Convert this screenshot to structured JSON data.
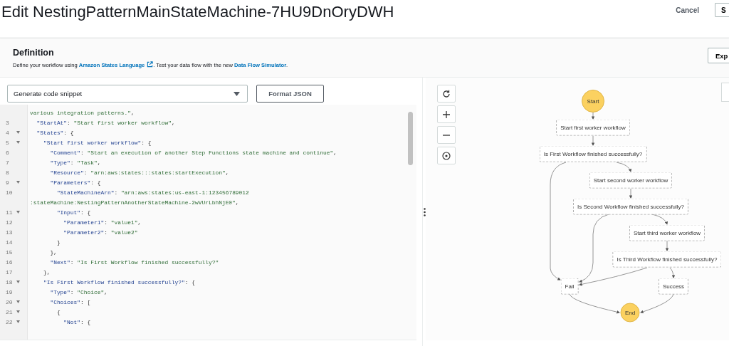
{
  "page": {
    "title": "Edit NestingPatternMainStateMachine-7HU9DnOryDWH",
    "cancel": "Cancel",
    "primary_button": "S"
  },
  "definition": {
    "heading": "Definition",
    "text_before": "Define your workflow using ",
    "link_1": "Amazon States Language",
    "text_middle": ". Test your data flow with the new ",
    "link_2": "Data Flow Simulator",
    "text_after": ".",
    "export_button": "Exp"
  },
  "toolbar": {
    "snippet_select": "Generate code snippet",
    "format_button": "Format JSON"
  },
  "code_lines": [
    {
      "foldable": false,
      "tokens": [
        {
          "kind": "string",
          "text": "various integration patterns.\""
        },
        {
          "kind": "punct",
          "text": ","
        }
      ]
    },
    {
      "number": "3",
      "foldable": false,
      "tokens": [
        {
          "kind": "key",
          "text": "  \"StartAt\""
        },
        {
          "kind": "punct",
          "text": ": "
        },
        {
          "kind": "string",
          "text": "\"Start first worker workflow\""
        },
        {
          "kind": "punct",
          "text": ","
        }
      ]
    },
    {
      "number": "4",
      "foldable": true,
      "tokens": [
        {
          "kind": "key",
          "text": "  \"States\""
        },
        {
          "kind": "punct",
          "text": ": {"
        }
      ]
    },
    {
      "number": "5",
      "foldable": true,
      "tokens": [
        {
          "kind": "key",
          "text": "    \"Start first worker workflow\""
        },
        {
          "kind": "punct",
          "text": ": {"
        }
      ]
    },
    {
      "number": "6",
      "foldable": false,
      "tokens": [
        {
          "kind": "key",
          "text": "      \"Comment\""
        },
        {
          "kind": "punct",
          "text": ": "
        },
        {
          "kind": "string",
          "text": "\"Start an execution of another Step Functions state machine and continue\""
        },
        {
          "kind": "punct",
          "text": ","
        }
      ]
    },
    {
      "number": "7",
      "foldable": false,
      "tokens": [
        {
          "kind": "key",
          "text": "      \"Type\""
        },
        {
          "kind": "punct",
          "text": ": "
        },
        {
          "kind": "string",
          "text": "\"Task\""
        },
        {
          "kind": "punct",
          "text": ","
        }
      ]
    },
    {
      "number": "8",
      "foldable": false,
      "tokens": [
        {
          "kind": "key",
          "text": "      \"Resource\""
        },
        {
          "kind": "punct",
          "text": ": "
        },
        {
          "kind": "string",
          "text": "\"arn:aws:states:::states:startExecution\""
        },
        {
          "kind": "punct",
          "text": ","
        }
      ]
    },
    {
      "number": "9",
      "foldable": true,
      "tokens": [
        {
          "kind": "key",
          "text": "      \"Parameters\""
        },
        {
          "kind": "punct",
          "text": ": {"
        }
      ]
    },
    {
      "number": "10",
      "foldable": false,
      "tokens": [
        {
          "kind": "key",
          "text": "        \"StateMachineArn\""
        },
        {
          "kind": "punct",
          "text": ": "
        },
        {
          "kind": "string",
          "text": "\"arn:aws:states:us-east-1:123456789012"
        }
      ]
    },
    {
      "foldable": false,
      "tokens": [
        {
          "kind": "string",
          "text": ":stateMachine:NestingPatternAnotherStateMachine-2wVUrLbhNjE0\""
        },
        {
          "kind": "punct",
          "text": ","
        }
      ]
    },
    {
      "number": "11",
      "foldable": true,
      "tokens": [
        {
          "kind": "key",
          "text": "        \"Input\""
        },
        {
          "kind": "punct",
          "text": ": {"
        }
      ]
    },
    {
      "number": "12",
      "foldable": false,
      "tokens": [
        {
          "kind": "key",
          "text": "          \"Parameter1\""
        },
        {
          "kind": "punct",
          "text": ": "
        },
        {
          "kind": "string",
          "text": "\"value1\""
        },
        {
          "kind": "punct",
          "text": ","
        }
      ]
    },
    {
      "number": "13",
      "foldable": false,
      "tokens": [
        {
          "kind": "key",
          "text": "          \"Parameter2\""
        },
        {
          "kind": "punct",
          "text": ": "
        },
        {
          "kind": "string",
          "text": "\"value2\""
        }
      ]
    },
    {
      "number": "14",
      "foldable": false,
      "tokens": [
        {
          "kind": "punct",
          "text": "        }"
        }
      ]
    },
    {
      "number": "15",
      "foldable": false,
      "tokens": [
        {
          "kind": "punct",
          "text": "      },"
        }
      ]
    },
    {
      "number": "16",
      "foldable": false,
      "tokens": [
        {
          "kind": "key",
          "text": "      \"Next\""
        },
        {
          "kind": "punct",
          "text": ": "
        },
        {
          "kind": "string",
          "text": "\"Is First Workflow finished successfully?\""
        }
      ]
    },
    {
      "number": "17",
      "foldable": false,
      "tokens": [
        {
          "kind": "punct",
          "text": "    },"
        }
      ]
    },
    {
      "number": "18",
      "foldable": true,
      "tokens": [
        {
          "kind": "key",
          "text": "    \"Is First Workflow finished successfully?\""
        },
        {
          "kind": "punct",
          "text": ": {"
        }
      ]
    },
    {
      "number": "19",
      "foldable": false,
      "tokens": [
        {
          "kind": "key",
          "text": "      \"Type\""
        },
        {
          "kind": "punct",
          "text": ": "
        },
        {
          "kind": "string",
          "text": "\"Choice\""
        },
        {
          "kind": "punct",
          "text": ","
        }
      ]
    },
    {
      "number": "20",
      "foldable": true,
      "tokens": [
        {
          "kind": "key",
          "text": "      \"Choices\""
        },
        {
          "kind": "punct",
          "text": ": ["
        }
      ]
    },
    {
      "number": "21",
      "foldable": true,
      "tokens": [
        {
          "kind": "punct",
          "text": "        {"
        }
      ]
    },
    {
      "number": "22",
      "foldable": true,
      "tokens": [
        {
          "kind": "key",
          "text": "          \"Not\""
        },
        {
          "kind": "punct",
          "text": ": {"
        }
      ]
    }
  ],
  "graph": {
    "nodes": [
      {
        "label": "Start",
        "kind": "terminal"
      },
      {
        "label": "Start first worker workflow",
        "kind": "state"
      },
      {
        "label": "Is First Workflow finished successfully?",
        "kind": "state"
      },
      {
        "label": "Start second worker workflow",
        "kind": "state"
      },
      {
        "label": "Is Second Workflow finished successfully?",
        "kind": "state"
      },
      {
        "label": "Start third worker workflow",
        "kind": "state"
      },
      {
        "label": "Is Third Workflow finished successfully?",
        "kind": "state"
      },
      {
        "label": "Fail",
        "kind": "state"
      },
      {
        "label": "Success",
        "kind": "state"
      },
      {
        "label": "End",
        "kind": "terminal"
      }
    ]
  }
}
